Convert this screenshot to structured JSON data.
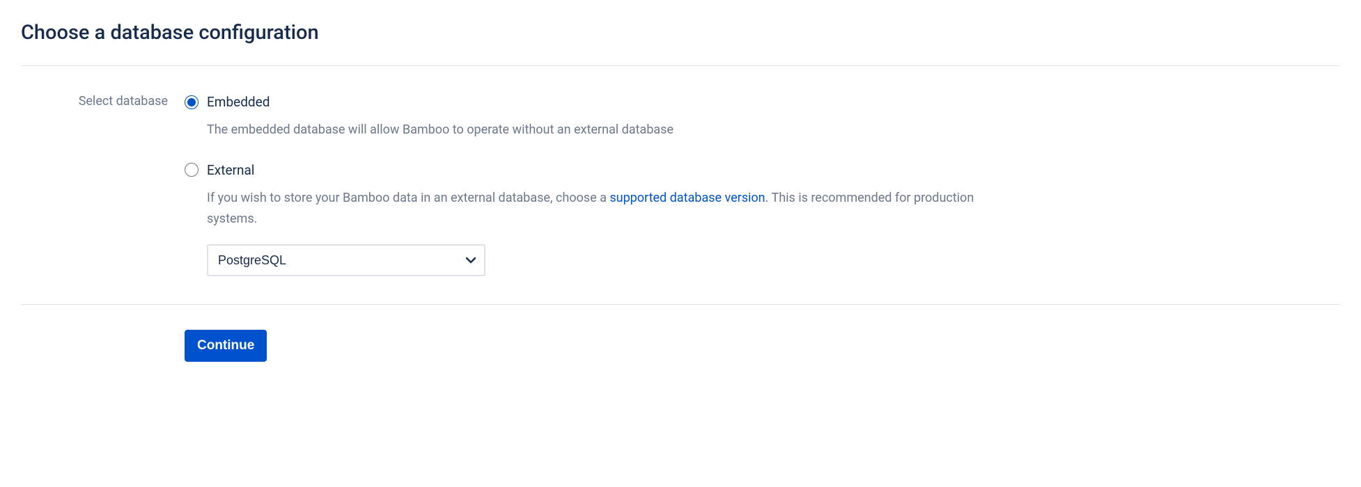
{
  "page": {
    "title": "Choose a database configuration"
  },
  "form": {
    "field_label": "Select database",
    "options": {
      "embedded": {
        "label": "Embedded",
        "description": "The embedded database will allow Bamboo to operate without an external database"
      },
      "external": {
        "label": "External",
        "description_pre": "If you wish to store your Bamboo data in an external database, choose a ",
        "description_link": "supported database version",
        "description_post": ". This is recommended for production systems."
      }
    },
    "db_select": {
      "selected": "PostgreSQL"
    }
  },
  "actions": {
    "continue": "Continue"
  }
}
